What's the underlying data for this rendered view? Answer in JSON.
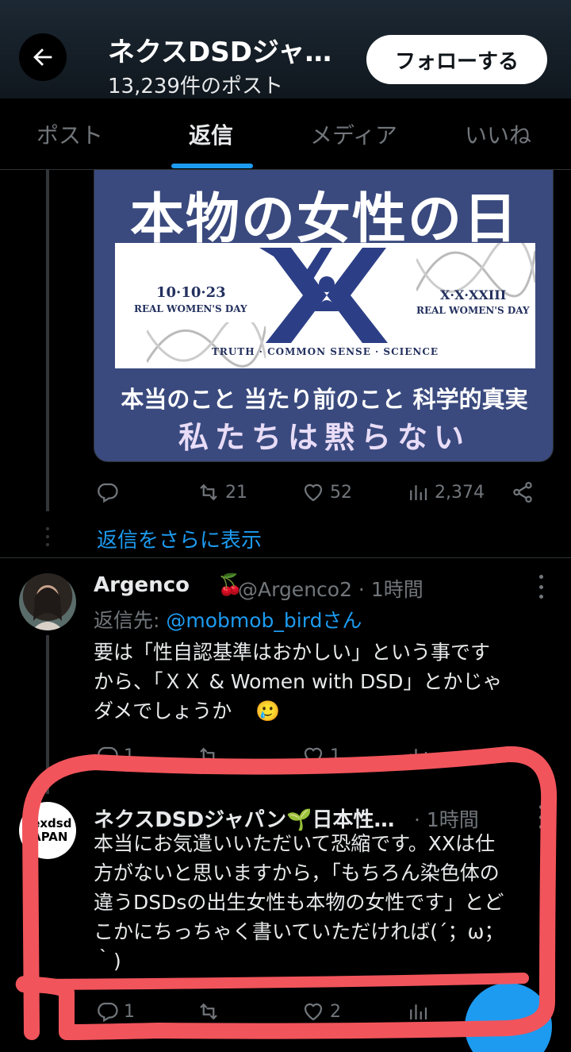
{
  "header": {
    "title": "ネクスDSDジャ…",
    "subtitle": "13,239件のポスト",
    "follow_label": "フォローする"
  },
  "tabs": [
    {
      "label": "ポスト",
      "active": false
    },
    {
      "label": "返信",
      "active": true
    },
    {
      "label": "メディア",
      "active": false
    },
    {
      "label": "いいね",
      "active": false
    }
  ],
  "image": {
    "title": "本物の女性の日",
    "date_left": "10·10·23",
    "caption_left": "REAL WOMEN'S DAY",
    "date_right": "X·X·XXIII",
    "caption_right": "REAL WOMEN'S DAY",
    "tagline": "TRUTH · COMMON SENSE · SCIENCE",
    "line1": "本当のこと 当たり前のこと 科学的真実",
    "line2": "私たちは黙らない"
  },
  "post1_actions": {
    "reply": "",
    "repost": "21",
    "like": "52",
    "views": "2,374"
  },
  "show_more": "返信をさらに表示",
  "reply1": {
    "name": "Argenco",
    "emoji": "🍒",
    "handle_time": "@Argenco2 · 1時間",
    "reply_to_prefix": "返信先: ",
    "reply_to_mention": "@mobmob_birdさん",
    "body_line1": "要は「性自認基準はおかしい」という事です",
    "body_line2": "から、「ＸＸ & Women with DSD」とかじゃ",
    "body_line3": "ダメでしょうか",
    "emoji_tail": "🥲",
    "actions": {
      "reply": "1",
      "repost": "",
      "like": "1"
    }
  },
  "reply2": {
    "name": "ネクスDSDジャパン🌱日本性…",
    "time": "· 1時間",
    "avatar_line1": "nexdsd",
    "avatar_line2": "JAPAN",
    "body_line1": "本当にお気遣いいただいて恐縮です。XXは仕",
    "body_line2": "方がないと思いますから，「もちろん染色体の",
    "body_line3": "違うDSDsの出生女性も本物の女性です」とど",
    "body_line4": "こかにちっちゃく書いていただければ(´；ω；",
    "body_line5": "｀)",
    "actions": {
      "reply": "1",
      "repost": "",
      "like": "2"
    }
  },
  "fab_label": "+",
  "colors": {
    "accent": "#1d9bf0",
    "annotation": "#f2545b",
    "card": "#3a4a7e"
  }
}
